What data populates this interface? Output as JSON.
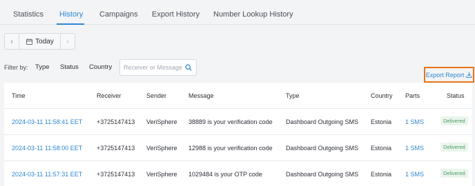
{
  "tabs": [
    {
      "label": "Statistics"
    },
    {
      "label": "History"
    },
    {
      "label": "Campaigns"
    },
    {
      "label": "Export History"
    },
    {
      "label": "Number Lookup History"
    }
  ],
  "date_nav": {
    "prev": "‹",
    "today": "Today",
    "next": "›"
  },
  "filters": {
    "label": "Filter by:",
    "type": "Type",
    "status": "Status",
    "country": "Country",
    "search_placeholder": "Receiver or Message I"
  },
  "export_report": "Export Report",
  "colors": {
    "accent": "#2d86d1",
    "highlight": "#e8731a",
    "delivered": "#4f9a61"
  },
  "table": {
    "headers": [
      "Time",
      "Receiver",
      "Sender",
      "Message",
      "Type",
      "Country",
      "Parts",
      "Status"
    ],
    "rows": [
      {
        "time": "2024-03-11 11:58:41 EET",
        "receiver": "+3725147413",
        "sender": "VeriSphere",
        "message": "38889 is your verification code",
        "type": "Dashboard Outgoing SMS",
        "country": "Estonia",
        "parts": "1 SMS",
        "status": "Delivered"
      },
      {
        "time": "2024-03-11 11:58:00 EET",
        "receiver": "+3725147413",
        "sender": "VeriSphere",
        "message": "12988 is your verification code",
        "type": "Dashboard Outgoing SMS",
        "country": "Estonia",
        "parts": "1 SMS",
        "status": "Delivered"
      },
      {
        "time": "2024-03-11 11:57:31 EET",
        "receiver": "+3725147413",
        "sender": "VeriSphere",
        "message": "1029484 is your OTP code",
        "type": "Dashboard Outgoing SMS",
        "country": "Estonia",
        "parts": "1 SMS",
        "status": "Delivered"
      }
    ]
  }
}
